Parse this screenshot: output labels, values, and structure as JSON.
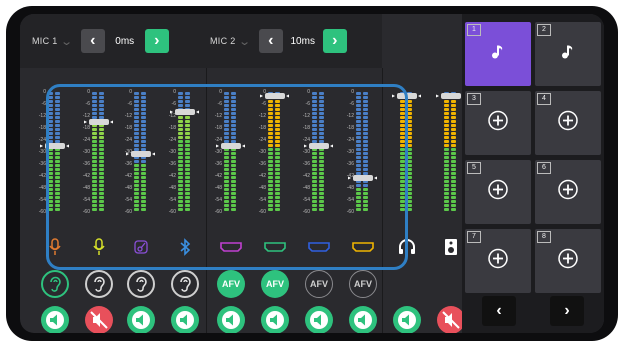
{
  "colors": {
    "green": "#2ec27e",
    "red": "#e8505b",
    "purple": "#7b4fd8",
    "blue": "#2f7fc4",
    "yellow": "#f0b400",
    "meter_blue": "#4a7fc6",
    "meter_green": "#5cc84a"
  },
  "topbar": {
    "mic1": {
      "label": "MIC 1",
      "delay": "0ms"
    },
    "mic2": {
      "label": "MIC 2",
      "delay": "10ms"
    }
  },
  "scale_ticks": [
    "0",
    "-6",
    "-12",
    "-18",
    "-24",
    "-30",
    "-36",
    "-42",
    "-48",
    "-54",
    "-60"
  ],
  "channels": [
    {
      "name": "mic-1",
      "icon": "microphone-icon",
      "icon_color": "#e07a30",
      "level": 0.55,
      "fader": 0.45,
      "meter": "green",
      "afv": null,
      "monitor": "ear-on",
      "speaker": "on"
    },
    {
      "name": "mic-2",
      "icon": "microphone-icon",
      "icon_color": "#d6e02a",
      "level": 0.78,
      "fader": 0.25,
      "meter": "green",
      "afv": null,
      "monitor": "ear-off",
      "speaker": "mute"
    },
    {
      "name": "instrument",
      "icon": "guitar-icon",
      "icon_color": "#8a4fd8",
      "level": 0.4,
      "fader": 0.52,
      "meter": "green",
      "afv": null,
      "monitor": "ear-off",
      "speaker": "on"
    },
    {
      "name": "bluetooth",
      "icon": "bluetooth-icon",
      "icon_color": "#3a8fe0",
      "level": 0.82,
      "fader": 0.17,
      "meter": "green",
      "afv": null,
      "monitor": "ear-off",
      "speaker": "on"
    },
    {
      "name": "hdmi-1",
      "icon": "hdmi-icon",
      "icon_color": "#c040d0",
      "level": 0.55,
      "fader": 0.45,
      "meter": "green",
      "afv": "on",
      "monitor": null,
      "speaker": "on"
    },
    {
      "name": "hdmi-2",
      "icon": "hdmi-icon",
      "icon_color": "#2ec27e",
      "level": 0.95,
      "fader": 0.03,
      "meter": "yellow",
      "afv": "on",
      "monitor": null,
      "speaker": "on"
    },
    {
      "name": "hdmi-3",
      "icon": "hdmi-icon",
      "icon_color": "#3060e0",
      "level": 0.55,
      "fader": 0.45,
      "meter": "green",
      "afv": "off",
      "monitor": null,
      "speaker": "on"
    },
    {
      "name": "hdmi-4",
      "icon": "hdmi-icon",
      "icon_color": "#f0b400",
      "level": 0.2,
      "fader": 0.72,
      "meter": "green",
      "afv": "off",
      "monitor": null,
      "speaker": "on"
    },
    {
      "name": "headphones",
      "icon": "headphones-icon",
      "icon_color": "#ffffff",
      "level": 0.95,
      "fader": 0.03,
      "meter": "yellow",
      "afv": null,
      "monitor": null,
      "speaker": "on"
    },
    {
      "name": "speaker-out",
      "icon": "speaker-icon",
      "icon_color": "#ffffff",
      "level": 0.95,
      "fader": 0.03,
      "meter": "yellow",
      "afv": null,
      "monitor": null,
      "speaker": "mute"
    }
  ],
  "afv_label": "AFV",
  "pads": [
    {
      "num": "1",
      "state": "active",
      "icon": "music-note-icon"
    },
    {
      "num": "2",
      "state": "loaded",
      "icon": "music-note-icon"
    },
    {
      "num": "3",
      "state": "empty",
      "icon": "plus-icon"
    },
    {
      "num": "4",
      "state": "empty",
      "icon": "plus-icon"
    },
    {
      "num": "5",
      "state": "empty",
      "icon": "plus-icon"
    },
    {
      "num": "6",
      "state": "empty",
      "icon": "plus-icon"
    },
    {
      "num": "7",
      "state": "empty",
      "icon": "plus-icon"
    },
    {
      "num": "8",
      "state": "empty",
      "icon": "plus-icon"
    }
  ],
  "pad_nav": {
    "prev": "‹",
    "next": "›"
  }
}
